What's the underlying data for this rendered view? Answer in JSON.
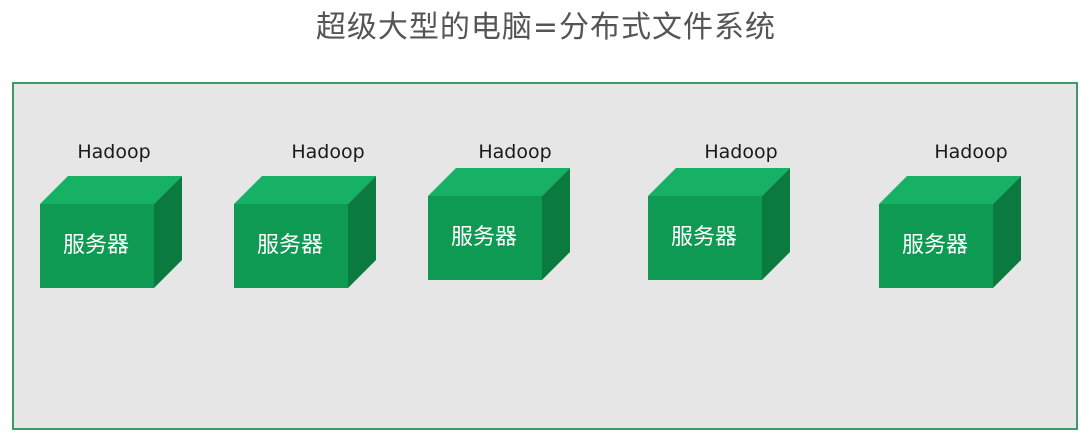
{
  "title": "超级大型的电脑=分布式文件系统",
  "colors": {
    "front": "#0f9a53",
    "top": "#16b165",
    "side": "#0a7a3f",
    "panel_bg": "#e6e6e6",
    "panel_border": "#3f9a6a"
  },
  "nodes": [
    {
      "label": "Hadoop",
      "box_label": "服务器"
    },
    {
      "label": "Hadoop",
      "box_label": "服务器"
    },
    {
      "label": "Hadoop",
      "box_label": "服务器"
    },
    {
      "label": "Hadoop",
      "box_label": "服务器"
    },
    {
      "label": "Hadoop",
      "box_label": "服务器"
    }
  ]
}
